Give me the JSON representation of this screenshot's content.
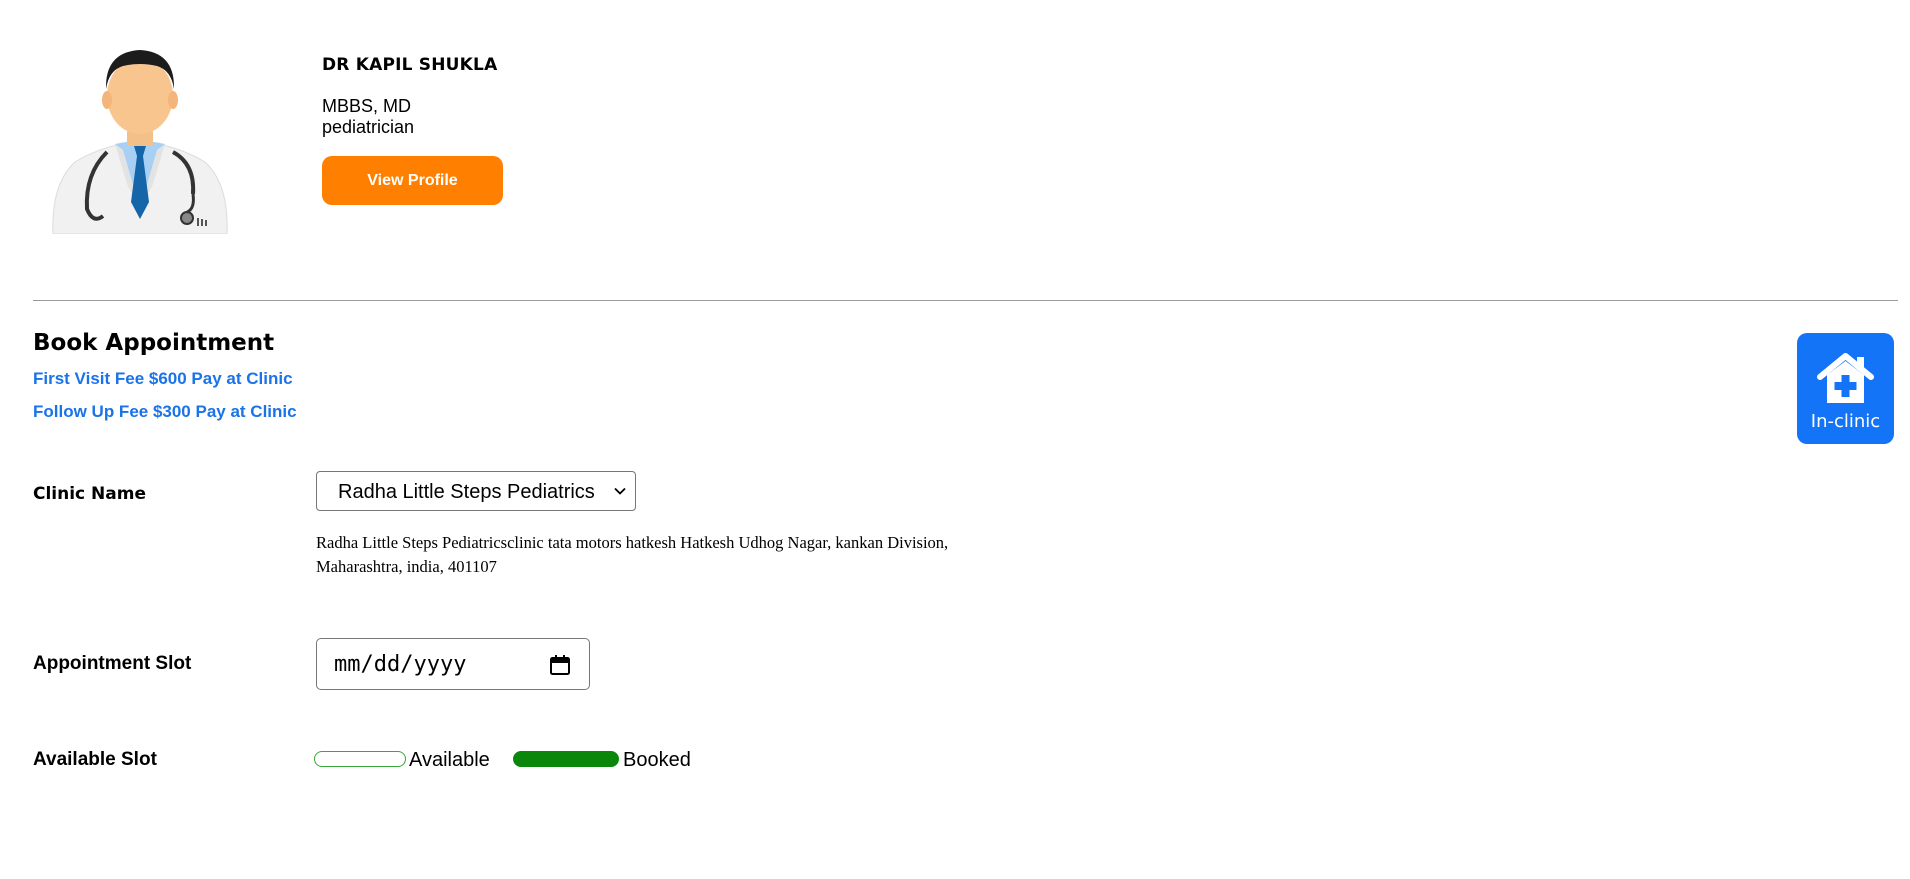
{
  "doctor": {
    "name": "DR KAPIL SHUKLA",
    "degree": "MBBS, MD",
    "speciality": "pediatrician",
    "view_profile_label": "View Profile",
    "avatar_icon": "doctor-avatar"
  },
  "booking": {
    "title": "Book Appointment",
    "first_visit_fee": "First Visit Fee $600 Pay at Clinic",
    "follow_up_fee": "Follow Up Fee $300 Pay at Clinic",
    "mode_badge": {
      "label": "In-clinic",
      "icon": "house-medical-icon",
      "color": "#1474f7"
    },
    "clinic_name_label": "Clinic Name",
    "clinic_selected": "Radha Little Steps Pediatrics",
    "clinic_address": "Radha Little Steps Pediatricsclinic tata motors hatkesh Hatkesh Udhog Nagar, kankan Division, Maharashtra, india, 401107",
    "appointment_slot_label": "Appointment Slot",
    "date_placeholder": "mm/dd/yyyy",
    "available_slot_label": "Available Slot",
    "legend": {
      "available_label": "Available",
      "booked_label": "Booked",
      "available_color": "#3aa53a",
      "booked_color": "#0a870a"
    }
  },
  "colors": {
    "accent_orange": "#ff8000",
    "link_blue": "#1a73e8"
  }
}
